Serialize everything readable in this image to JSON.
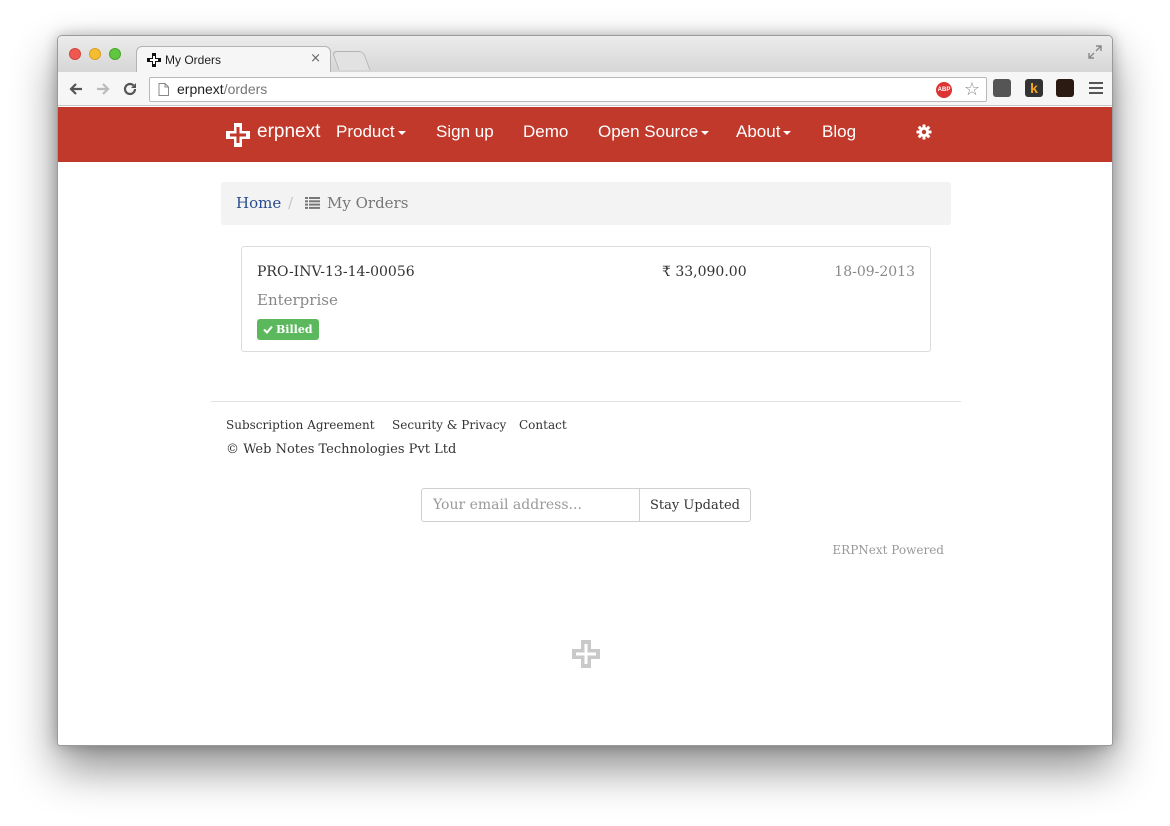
{
  "browser": {
    "tab_title": "My Orders",
    "tab_close": "×",
    "url_host": "erpnext",
    "url_path": "/orders",
    "adblock_label": "ABP",
    "extension_k_label": "k"
  },
  "navbar": {
    "brand": "erpnext",
    "items": [
      {
        "label": "Product",
        "dropdown": true
      },
      {
        "label": "Sign up",
        "dropdown": false
      },
      {
        "label": "Demo",
        "dropdown": false
      },
      {
        "label": "Open Source",
        "dropdown": true
      },
      {
        "label": "About",
        "dropdown": true
      },
      {
        "label": "Blog",
        "dropdown": false
      }
    ],
    "color": "#c0392b"
  },
  "breadcrumb": {
    "home": "Home",
    "separator": "/",
    "current": "My Orders"
  },
  "order": {
    "id": "PRO-INV-13-14-00056",
    "amount": "₹ 33,090.00",
    "date": "18-09-2013",
    "product": "Enterprise",
    "status": "Billed",
    "status_color": "#5cb85c"
  },
  "footer": {
    "links": [
      "Subscription Agreement",
      "Security & Privacy",
      "Contact"
    ],
    "copyright": "© Web Notes Technologies Pvt Ltd",
    "email_placeholder": "Your email address...",
    "subscribe_button": "Stay Updated",
    "powered": "ERPNext Powered"
  }
}
